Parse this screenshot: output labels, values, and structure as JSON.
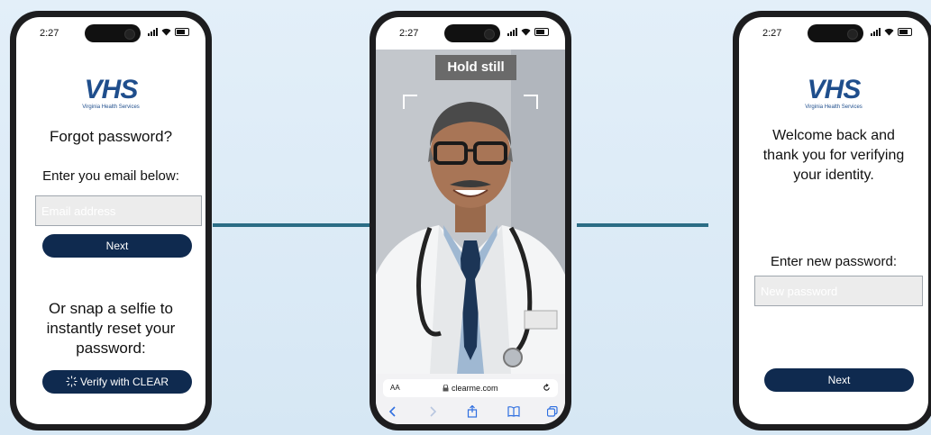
{
  "colors": {
    "accent": "#0f2a4f",
    "arrow": "#2b6d85",
    "logo": "#1f4e8c"
  },
  "phone1": {
    "time": "2:27",
    "logo_text": "VHS",
    "logo_subtitle": "Virginia Health Services",
    "heading": "Forgot password?",
    "email_prompt": "Enter you email below:",
    "email_placeholder": "Email address",
    "next_label": "Next",
    "selfie_text": "Or snap a selfie to instantly reset your password:",
    "clear_label": "Verify with CLEAR",
    "clear_icon": "sparkle-ring-icon"
  },
  "phone2": {
    "time": "2:27",
    "hold_label": "Hold still",
    "url_aa": "AA",
    "url": "clearme.com",
    "nav_icons": [
      "back-icon",
      "forward-icon",
      "share-icon",
      "bookmarks-icon",
      "tabs-icon"
    ]
  },
  "phone3": {
    "time": "2:27",
    "logo_text": "VHS",
    "logo_subtitle": "Virginia Health Services",
    "welcome": "Welcome back and thank you for verifying your identity.",
    "password_prompt": "Enter new password:",
    "password_placeholder": "New password",
    "next_label": "Next"
  }
}
